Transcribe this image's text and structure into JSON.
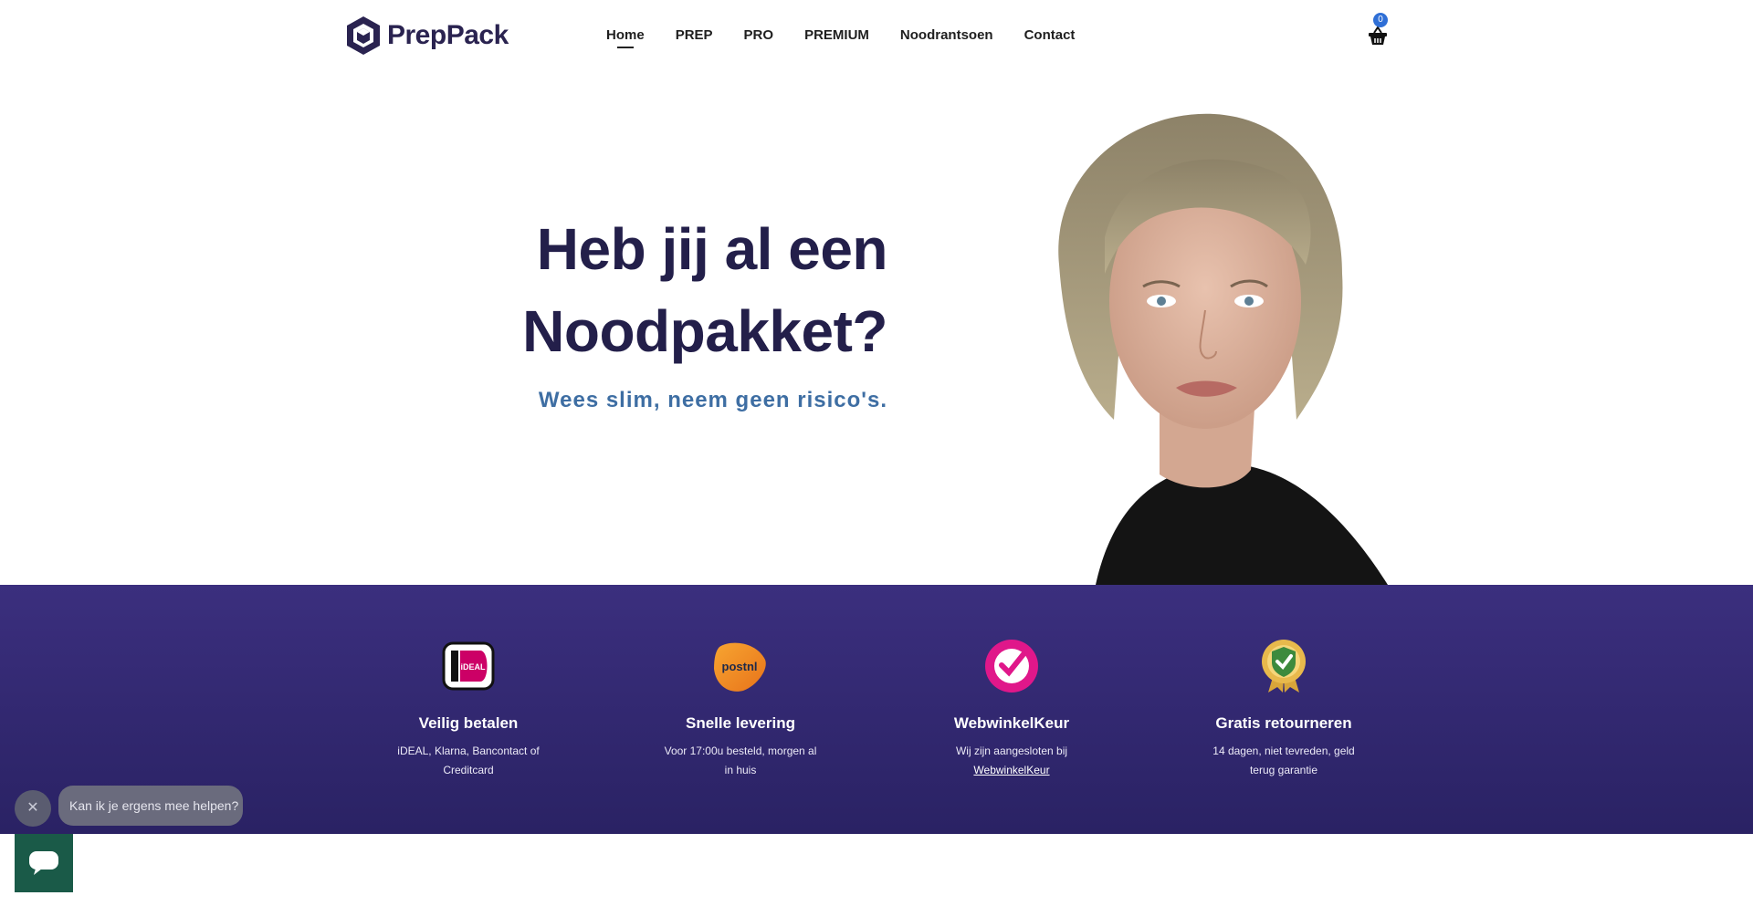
{
  "brand": {
    "name": "PrepPack",
    "color": "#2a2350"
  },
  "nav": {
    "items": [
      {
        "label": "Home",
        "active": true
      },
      {
        "label": "PREP",
        "active": false
      },
      {
        "label": "PRO",
        "active": false
      },
      {
        "label": "PREMIUM",
        "active": false
      },
      {
        "label": "Noodrantsoen",
        "active": false
      },
      {
        "label": "Contact",
        "active": false
      }
    ]
  },
  "cart": {
    "count": "0",
    "icon": "basket-icon"
  },
  "hero": {
    "title_line1": "Heb jij al een",
    "title_line2": "Noodpakket?",
    "subtitle": "Wees slim, neem geen risico's.",
    "title_color": "#231f4a",
    "subtitle_color": "#3e6ea3"
  },
  "features": [
    {
      "icon": "ideal-icon",
      "title": "Veilig betalen",
      "desc1": "iDEAL, Klarna, Bancontact of",
      "desc2": "Creditcard"
    },
    {
      "icon": "postnl-icon",
      "title": "Snelle levering",
      "desc1": "Voor 17:00u besteld, morgen al",
      "desc2": "in huis"
    },
    {
      "icon": "webwinkelkeur-icon",
      "title": "WebwinkelKeur",
      "desc1": "Wij zijn aangesloten bij",
      "link": "WebwinkelKeur"
    },
    {
      "icon": "guarantee-badge-icon",
      "title": "Gratis retourneren",
      "desc1": "14 dagen, niet tevreden, geld",
      "desc2": "terug garantie"
    }
  ],
  "band_color": "#3b2f7e",
  "chat": {
    "message": "Kan ik je ergens mee helpen?",
    "close_symbol": "✕",
    "button_color": "#1a5a48"
  }
}
